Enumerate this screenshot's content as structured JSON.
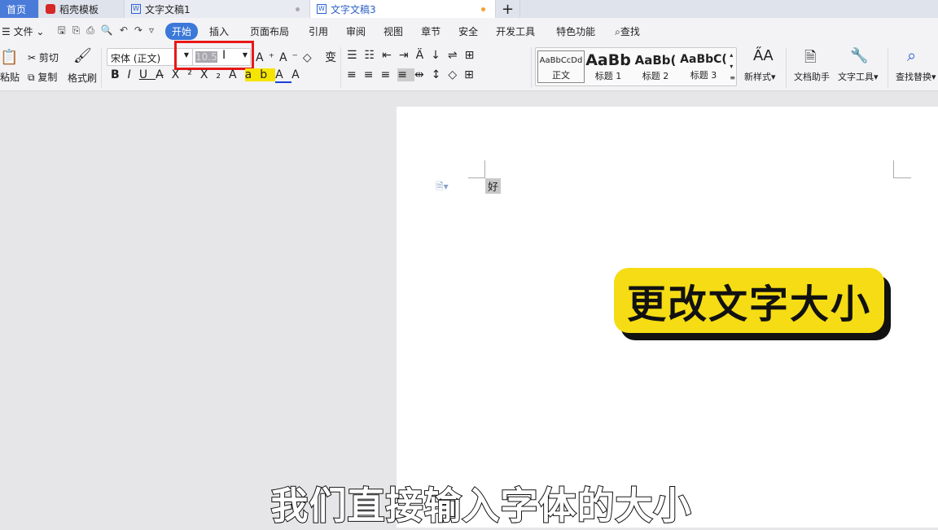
{
  "tabs": [
    {
      "label": "首页"
    },
    {
      "label": "稻壳模板"
    },
    {
      "label": "文字文稿1"
    },
    {
      "label": "文字文稿3"
    }
  ],
  "menu": {
    "file": "文件",
    "items": [
      "开始",
      "插入",
      "页面布局",
      "引用",
      "审阅",
      "视图",
      "章节",
      "安全",
      "开发工具",
      "特色功能"
    ],
    "search": "查找"
  },
  "ribbon": {
    "paste": "粘贴",
    "cut": "剪切",
    "copy": "复制",
    "format_painter": "格式刷",
    "font_name": "宋体 (正文)",
    "font_size": "10.5",
    "styles": [
      {
        "preview": "AaBbCcDd",
        "label": "正文"
      },
      {
        "preview": "AaBb",
        "label": "标题 1"
      },
      {
        "preview": "AaBb(",
        "label": "标题 2"
      },
      {
        "preview": "AaBbC(",
        "label": "标题 3"
      }
    ],
    "new_style": "新样式",
    "doc_helper": "文档助手",
    "text_tools": "文字工具",
    "find_replace": "查找替换"
  },
  "document": {
    "text": "好"
  },
  "overlay": {
    "badge": "更改文字大小",
    "subtitle": "我们直接输入字体的大小"
  },
  "colors": {
    "accent": "#3b78d8",
    "highlight": "#e81818",
    "badge": "#f5dc14"
  }
}
